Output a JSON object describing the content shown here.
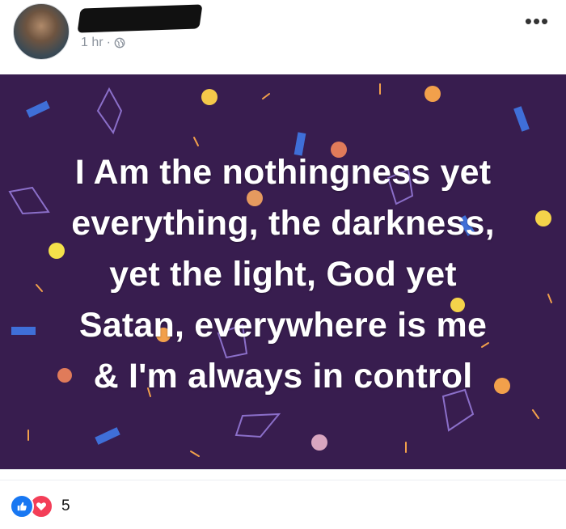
{
  "post": {
    "author": {
      "name": ""
    },
    "time": "1 hr",
    "separator": "·",
    "privacy_icon": "globe-icon",
    "more_icon": "more-icon",
    "more_label": "•••"
  },
  "image": {
    "background_color": "#381d4f",
    "quote_lines": [
      "I Am the nothingness yet",
      "everything, the darkness,",
      "yet the light, God yet",
      "Satan, everywhere is me",
      "& I'm always in control"
    ]
  },
  "reactions": {
    "icons": [
      "like-icon",
      "love-icon"
    ],
    "count": "5"
  },
  "colors": {
    "like": "#1877f2",
    "love": "#f33e58",
    "meta_text": "#8d949e"
  }
}
